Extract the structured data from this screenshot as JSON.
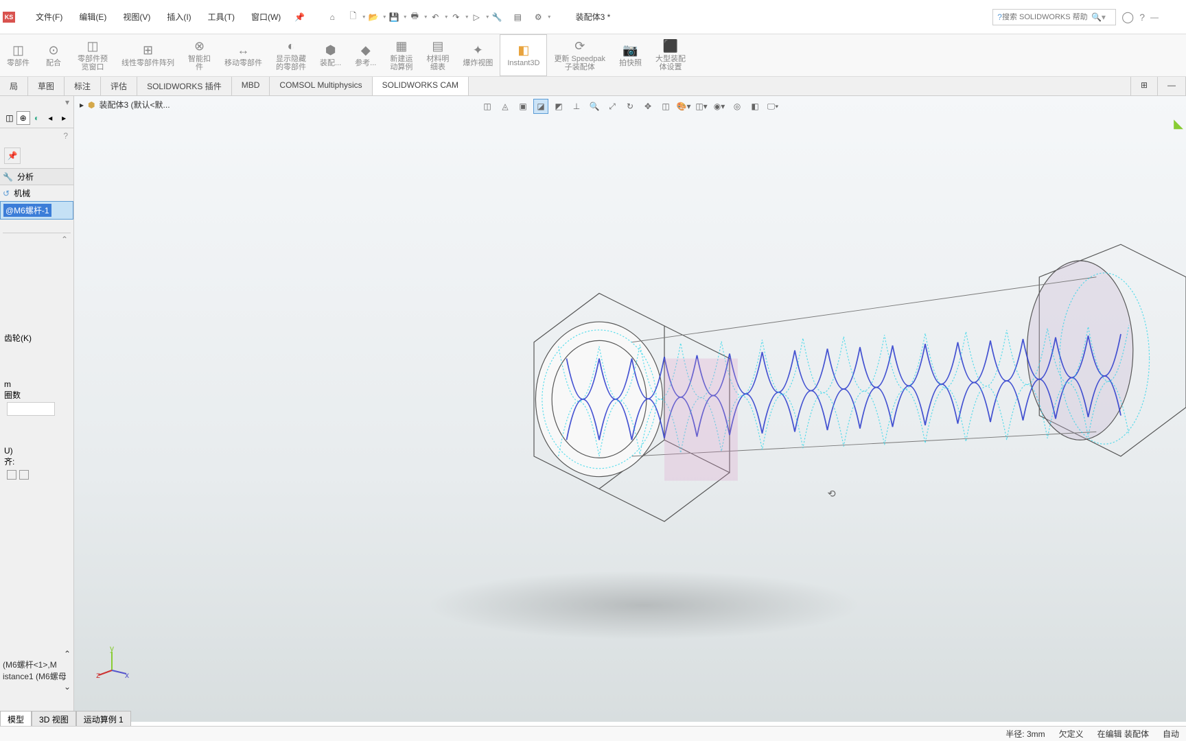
{
  "app_logo": "KS",
  "menubar": {
    "file": "文件(F)",
    "edit": "编辑(E)",
    "view": "视图(V)",
    "insert": "插入(I)",
    "tools": "工具(T)",
    "window": "窗口(W)"
  },
  "title": "装配体3 *",
  "search": {
    "placeholder": "搜索 SOLIDWORKS 帮助"
  },
  "ribbon_buttons": [
    {
      "label": "零部件"
    },
    {
      "label": "配合"
    },
    {
      "label": "零部件预\n览窗口"
    },
    {
      "label": "线性零部件阵列"
    },
    {
      "label": "智能扣\n件"
    },
    {
      "label": "移动零部件"
    },
    {
      "label": "显示隐藏\n的零部件"
    },
    {
      "label": "装配..."
    },
    {
      "label": "参考..."
    },
    {
      "label": "新建运\n动算例"
    },
    {
      "label": "材料明\n细表"
    },
    {
      "label": "爆炸视图"
    },
    {
      "label": "Instant3D",
      "active": true
    },
    {
      "label": "更新 Speedpak\n子装配体"
    },
    {
      "label": "拍快照"
    },
    {
      "label": "大型装配\n体设置"
    }
  ],
  "tabs": [
    "局",
    "草图",
    "标注",
    "评估",
    "SOLIDWORKS 插件",
    "MBD",
    "COMSOL Multiphysics",
    "SOLIDWORKS CAM"
  ],
  "breadcrumb_label": "装配体3 (默认<默...",
  "left_panel": {
    "analysis": "分析",
    "mech": "机械",
    "selected_item": "@M6螺杆-1",
    "gear_label": "齿轮(K)",
    "unit_label": "m",
    "turns_label": "圈数",
    "u_label": "U)",
    "align_label": "齐:",
    "bottom_line1": "(M6螺杆<1>,M",
    "bottom_line2": "istance1 (M6螺母"
  },
  "bottom_tabs": [
    "模型",
    "3D 视图",
    "运动算例 1"
  ],
  "status": {
    "radius": "半径: 3mm",
    "underdef": "欠定义",
    "editing": "在编辑 装配体",
    "auto": "自动"
  }
}
